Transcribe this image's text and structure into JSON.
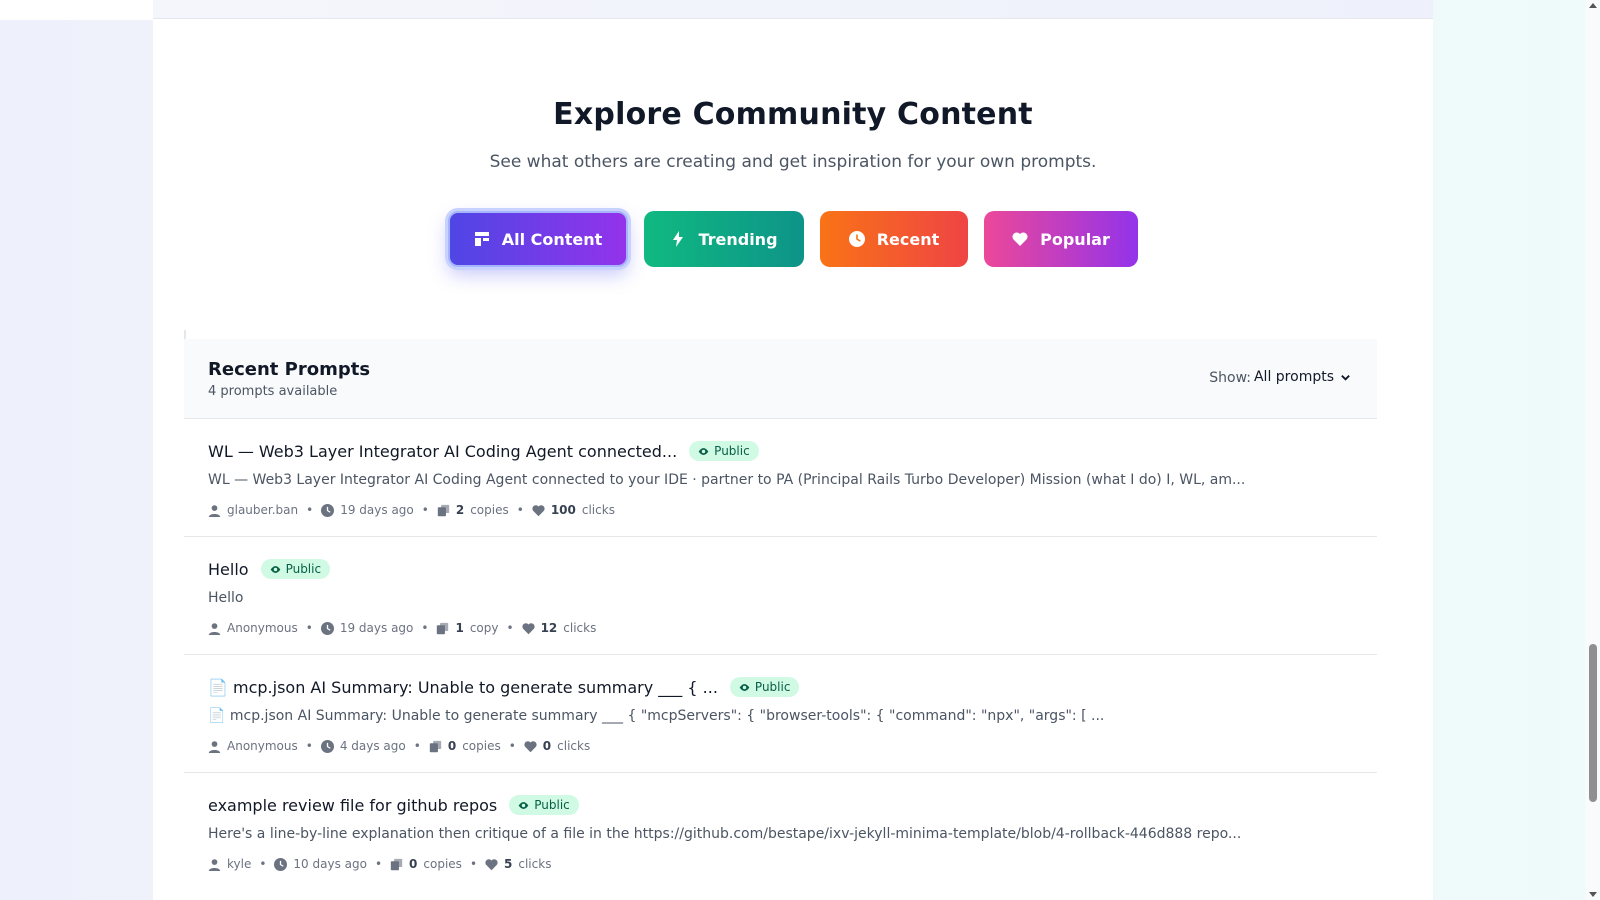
{
  "hero": {
    "title": "Explore Community Content",
    "subtitle": "See what others are creating and get inspiration for your own prompts."
  },
  "tabs": [
    {
      "label": "All Content",
      "icon": "layout-icon",
      "active": true
    },
    {
      "label": "Trending",
      "icon": "bolt-icon"
    },
    {
      "label": "Recent",
      "icon": "clock-icon"
    },
    {
      "label": "Popular",
      "icon": "heart-icon"
    }
  ],
  "list": {
    "title": "Recent Prompts",
    "count": "4 prompts available",
    "show_label": "Show:",
    "show_value": "All prompts"
  },
  "prompts": [
    {
      "title": "WL — Web3 Layer Integrator AI Coding Agent connected...",
      "badge": "Public",
      "description": "WL — Web3 Layer Integrator AI Coding Agent connected to your IDE · partner to PA (Principal Rails Turbo Developer) Mission (what I do) I, WL, am...",
      "author": "glauber.ban",
      "time": "19 days ago",
      "copies_num": "2",
      "copies_label": "copies",
      "clicks_num": "100",
      "clicks_label": "clicks"
    },
    {
      "title": "Hello",
      "badge": "Public",
      "description": "Hello",
      "author": "Anonymous",
      "time": "19 days ago",
      "copies_num": "1",
      "copies_label": "copy",
      "clicks_num": "12",
      "clicks_label": "clicks"
    },
    {
      "title": "📄 mcp.json AI Summary: Unable to generate summary ___ { ...",
      "badge": "Public",
      "description": "📄 mcp.json AI Summary: Unable to generate summary ___ { \"mcpServers\": { \"browser-tools\": { \"command\": \"npx\", \"args\": [ ...",
      "author": "Anonymous",
      "time": "4 days ago",
      "copies_num": "0",
      "copies_label": "copies",
      "clicks_num": "0",
      "clicks_label": "clicks"
    },
    {
      "title": "example review file for github repos",
      "badge": "Public",
      "description": "Here's a line-by-line explanation then critique of a file in the https://github.com/bestape/ixv-jekyll-minima-template/blob/4-rollback-446d888 repo...",
      "author": "kyle",
      "time": "10 days ago",
      "copies_num": "0",
      "copies_label": "copies",
      "clicks_num": "5",
      "clicks_label": "clicks"
    }
  ],
  "colors": {
    "all_content": "#6d28d9",
    "trending": "#10b981",
    "recent": "#f97316",
    "popular": "#ec4899",
    "badge_bg": "#d1fae5"
  }
}
